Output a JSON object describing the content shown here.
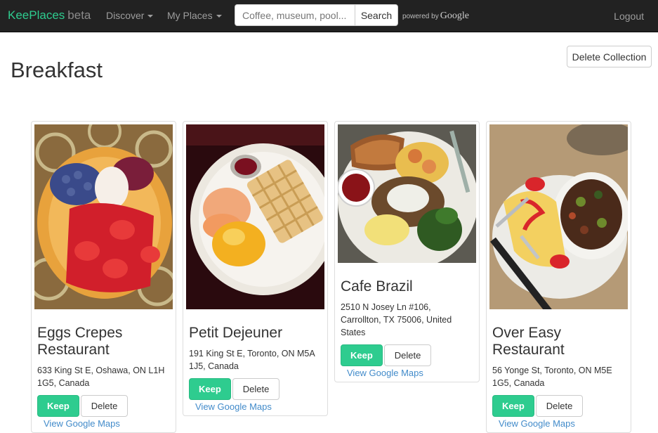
{
  "navbar": {
    "brand": "KeePlaces",
    "brand_suffix": "beta",
    "discover_label": "Discover",
    "my_places_label": "My Places",
    "search_placeholder": "Coffee, museum, pool...",
    "search_button": "Search",
    "powered_by": "powered by",
    "google": "Google",
    "logout": "Logout"
  },
  "page": {
    "title": "Breakfast",
    "delete_collection": "Delete Collection"
  },
  "places": [
    {
      "name": "Eggs Crepes Restaurant",
      "address": "633 King St E, Oshawa, ON L1H 1G5, Canada",
      "keep_label": "Keep",
      "delete_label": "Delete",
      "maps_label": "View Google Maps",
      "photo_icon": "crepes-photo"
    },
    {
      "name": "Petit Dejeuner",
      "address": "191 King St E, Toronto, ON M5A 1J5, Canada",
      "keep_label": "Keep",
      "delete_label": "Delete",
      "maps_label": "View Google Maps",
      "photo_icon": "waffle-photo"
    },
    {
      "name": "Cafe Brazil",
      "address": "2510 N Josey Ln #106, Carrollton, TX 75006, United States",
      "keep_label": "Keep",
      "delete_label": "Delete",
      "maps_label": "View Google Maps",
      "photo_icon": "breakfast-plate-photo"
    },
    {
      "name": "Over Easy Restaurant",
      "address": "56 Yonge St, Toronto, ON M5E 1G5, Canada",
      "keep_label": "Keep",
      "delete_label": "Delete",
      "maps_label": "View Google Maps",
      "photo_icon": "omelette-photo"
    }
  ],
  "colors": {
    "navbar_bg": "#222222",
    "brand": "#2ecc8f",
    "keep_button": "#2ecc8f",
    "link": "#428bca"
  }
}
